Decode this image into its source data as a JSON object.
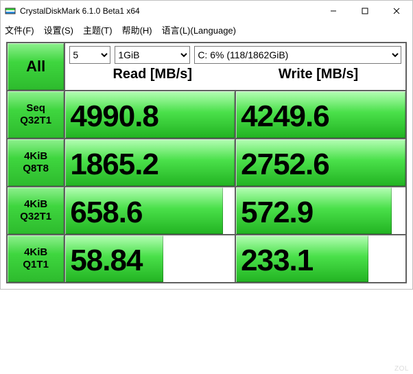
{
  "window": {
    "title": "CrystalDiskMark 6.1.0 Beta1 x64"
  },
  "menu": {
    "file": "文件(F)",
    "settings": "设置(S)",
    "theme": "主题(T)",
    "help": "帮助(H)",
    "language": "语言(L)(Language)"
  },
  "controls": {
    "iterations": "5",
    "test_size": "1GiB",
    "drive": "C: 6% (118/1862GiB)",
    "read_header": "Read [MB/s]",
    "write_header": "Write [MB/s]"
  },
  "buttons": {
    "all": "All",
    "seq_q32t1_l1": "Seq",
    "seq_q32t1_l2": "Q32T1",
    "k4_q8t8_l1": "4KiB",
    "k4_q8t8_l2": "Q8T8",
    "k4_q32t1_l1": "4KiB",
    "k4_q32t1_l2": "Q32T1",
    "k4_q1t1_l1": "4KiB",
    "k4_q1t1_l2": "Q1T1"
  },
  "chart_data": {
    "type": "table",
    "title": "CrystalDiskMark 6.1.0 benchmark results",
    "columns": [
      "Read [MB/s]",
      "Write [MB/s]"
    ],
    "rows": [
      {
        "name": "Seq Q32T1",
        "read": 4990.8,
        "write": 4249.6,
        "read_fill": 100,
        "write_fill": 100
      },
      {
        "name": "4KiB Q8T8",
        "read": 1865.2,
        "write": 2752.6,
        "read_fill": 100,
        "write_fill": 100
      },
      {
        "name": "4KiB Q32T1",
        "read": 658.6,
        "write": 572.9,
        "read_fill": 93,
        "write_fill": 92
      },
      {
        "name": "4KiB Q1T1",
        "read": 58.84,
        "write": 233.1,
        "read_fill": 58,
        "write_fill": 78
      }
    ]
  },
  "watermark": "ZOL"
}
